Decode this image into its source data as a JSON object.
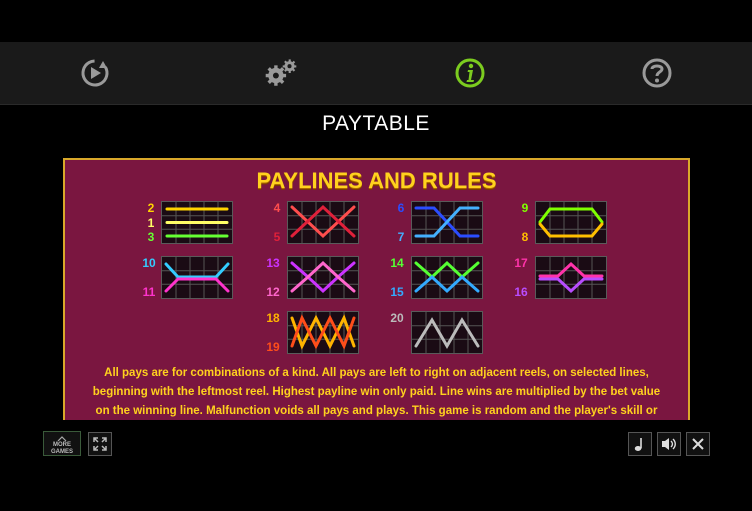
{
  "title": "PAYTABLE",
  "panel": {
    "heading": "PAYLINES AND RULES",
    "rules": [
      "All pays are for combinations of a kind. All pays are left to right on adjacent reels, on selected lines,",
      "beginning with the leftmost reel. Highest payline win only paid. Line wins are multiplied by the bet value",
      "on the winning line. Malfunction voids all pays and plays. This game is random and the player's skill or"
    ]
  },
  "paylines": [
    {
      "numbers": [
        "2",
        "1",
        "3"
      ],
      "colors": [
        "#ffd400",
        "#ffff66",
        "#66ff33"
      ]
    },
    {
      "numbers": [
        "4",
        "5"
      ],
      "colors": [
        "#ff4d4d",
        "#e0203a"
      ]
    },
    {
      "numbers": [
        "6",
        "7"
      ],
      "colors": [
        "#2b4dff",
        "#44b0ff"
      ]
    },
    {
      "numbers": [
        "9",
        "8"
      ],
      "colors": [
        "#7fff00",
        "#ffbf00"
      ]
    },
    {
      "numbers": [
        "10",
        "11"
      ],
      "colors": [
        "#33ccff",
        "#ff33cc"
      ]
    },
    {
      "numbers": [
        "13",
        "12"
      ],
      "colors": [
        "#cc33ff",
        "#ff66cc"
      ]
    },
    {
      "numbers": [
        "14",
        "15"
      ],
      "colors": [
        "#55ff33",
        "#33aaff"
      ]
    },
    {
      "numbers": [
        "17",
        "16"
      ],
      "colors": [
        "#ff33aa",
        "#b84dff"
      ]
    },
    {
      "numbers": [
        "18",
        "19"
      ],
      "colors": [
        "#ffb400",
        "#ff4d1a"
      ]
    },
    {
      "numbers": [
        "20"
      ],
      "colors": [
        "#bbbbbb"
      ]
    }
  ],
  "toolbar": {
    "icons": [
      "replay-icon",
      "settings-icon",
      "info-icon",
      "help-icon"
    ],
    "active_color": "#7ccc1f"
  },
  "bottom": {
    "more_games": "MORE GAMES"
  }
}
